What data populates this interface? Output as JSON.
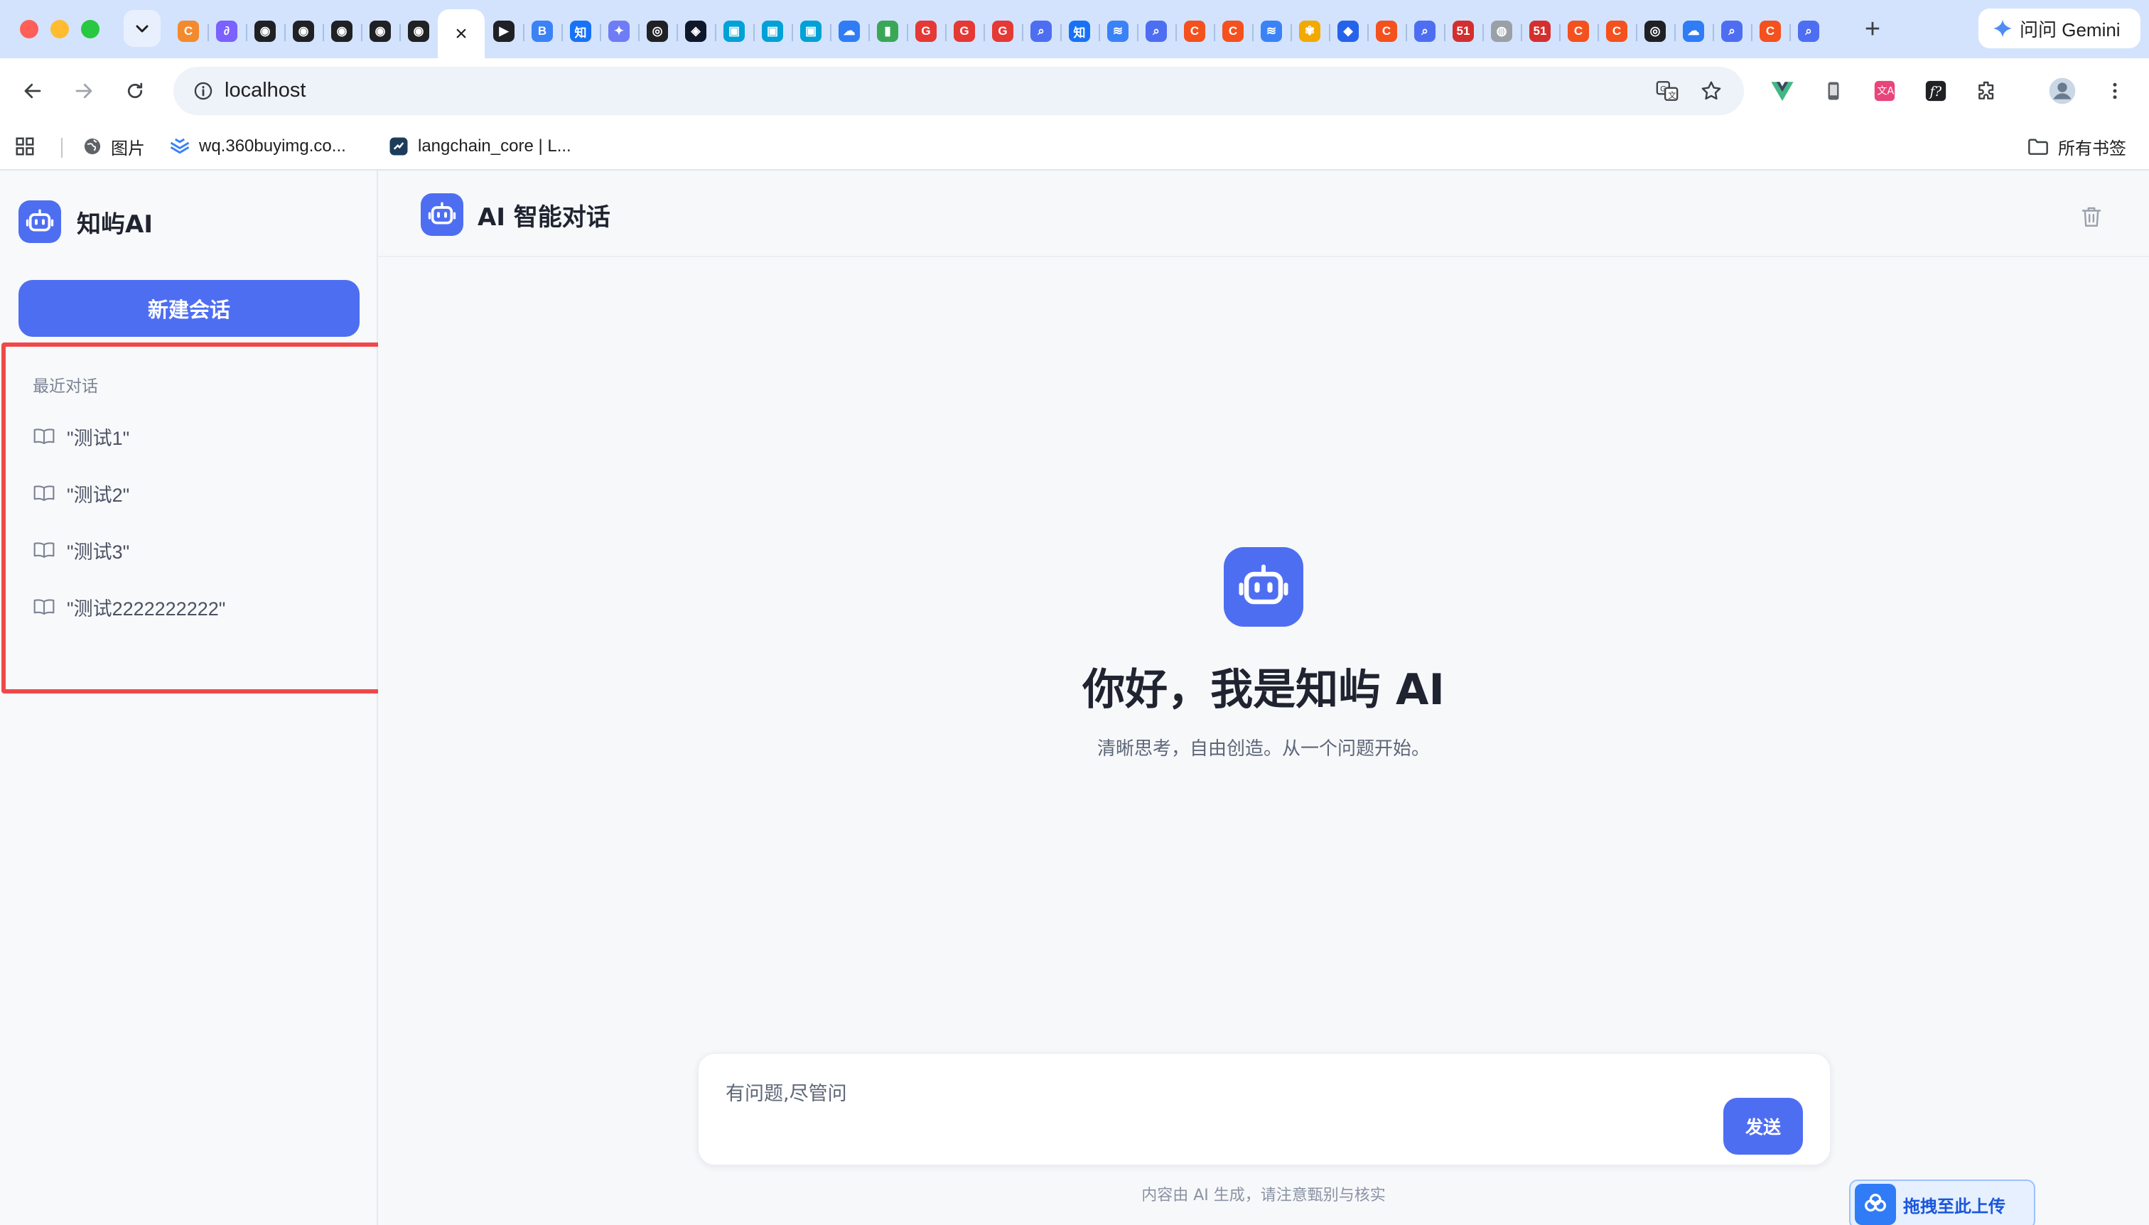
{
  "browser": {
    "address": "localhost",
    "gemini_label": "问问 Gemini",
    "bookmarks": [
      {
        "label": "图片",
        "icon": "globe-icon"
      },
      {
        "label": "wq.360buyimg.co...",
        "icon": "layers-icon"
      },
      {
        "label": "langchain_core | L...",
        "icon": "bookmark-favicon"
      }
    ],
    "all_bookmarks_label": "所有书签",
    "tab_favicons": [
      {
        "glyph": "C",
        "color": "#f48a2e"
      },
      {
        "glyph": "∂",
        "color": "#7b61ff"
      },
      {
        "glyph": "◉",
        "color": "#202124"
      },
      {
        "glyph": "◉",
        "color": "#202124"
      },
      {
        "glyph": "◉",
        "color": "#202124"
      },
      {
        "glyph": "◉",
        "color": "#202124"
      },
      {
        "glyph": "◉",
        "color": "#202124"
      },
      {
        "glyph": "×",
        "color": "active"
      },
      {
        "glyph": "▶",
        "color": "#202124"
      },
      {
        "glyph": "B",
        "color": "#3b82f6"
      },
      {
        "glyph": "知",
        "color": "#1772f6"
      },
      {
        "glyph": "✦",
        "color": "#6f7cf6"
      },
      {
        "glyph": "◎",
        "color": "#202124"
      },
      {
        "glyph": "◈",
        "color": "#0f172a"
      },
      {
        "glyph": "▣",
        "color": "#00a1d6"
      },
      {
        "glyph": "▣",
        "color": "#00a1d6"
      },
      {
        "glyph": "▣",
        "color": "#00a1d6"
      },
      {
        "glyph": "☁",
        "color": "#2f7cf6"
      },
      {
        "glyph": "▮",
        "color": "#3aa757"
      },
      {
        "glyph": "G",
        "color": "#e53935"
      },
      {
        "glyph": "G",
        "color": "#e53935"
      },
      {
        "glyph": "G",
        "color": "#e53935"
      },
      {
        "glyph": "⌕",
        "color": "#4e6ef2"
      },
      {
        "glyph": "知",
        "color": "#1772f6"
      },
      {
        "glyph": "≋",
        "color": "#3b82f6"
      },
      {
        "glyph": "⌕",
        "color": "#4e6ef2"
      },
      {
        "glyph": "C",
        "color": "#f4511e"
      },
      {
        "glyph": "C",
        "color": "#f4511e"
      },
      {
        "glyph": "≋",
        "color": "#3b82f6"
      },
      {
        "glyph": "✾",
        "color": "#f2a900"
      },
      {
        "glyph": "◆",
        "color": "#2563eb"
      },
      {
        "glyph": "C",
        "color": "#f4511e"
      },
      {
        "glyph": "⌕",
        "color": "#4e6ef2"
      },
      {
        "glyph": "51",
        "color": "#d32f2f"
      },
      {
        "glyph": "◍",
        "color": "#9aa0a6"
      },
      {
        "glyph": "51",
        "color": "#d32f2f"
      },
      {
        "glyph": "C",
        "color": "#f4511e"
      },
      {
        "glyph": "C",
        "color": "#f4511e"
      },
      {
        "glyph": "◎",
        "color": "#202124"
      },
      {
        "glyph": "☁",
        "color": "#2f7cf6"
      },
      {
        "glyph": "⌕",
        "color": "#4e6ef2"
      },
      {
        "glyph": "C",
        "color": "#f4511e"
      },
      {
        "glyph": "⌕",
        "color": "#4e6ef2"
      }
    ]
  },
  "sidebar": {
    "brand_name": "知屿AI",
    "new_chat_label": "新建会话",
    "recent_title": "最近对话",
    "conversations": [
      {
        "title": "\"测试1\""
      },
      {
        "title": "\"测试2\""
      },
      {
        "title": "\"测试3\""
      },
      {
        "title": "\"测试2222222222\""
      }
    ]
  },
  "header": {
    "title": "AI 智能对话"
  },
  "welcome": {
    "title": "你好，我是知屿 AI",
    "subtitle": "清晰思考，自由创造。从一个问题开始。"
  },
  "composer": {
    "placeholder": "有问题,尽管问",
    "send_label": "发送",
    "disclaimer": "内容由 AI 生成，请注意甄别与核实"
  },
  "upload": {
    "label": "拖拽至此上传"
  },
  "colors": {
    "accent": "#4e6ef2",
    "highlight_border": "#f0484a"
  }
}
